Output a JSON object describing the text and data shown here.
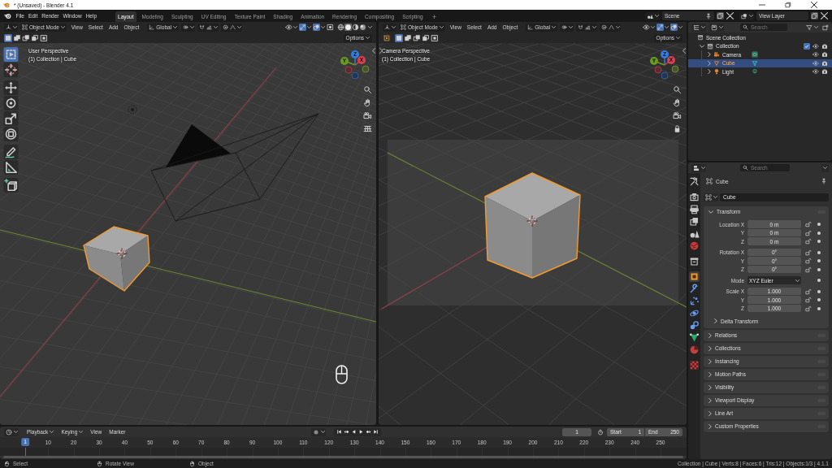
{
  "window": {
    "title": "* (Unsaved) - Blender 4.1"
  },
  "menu": [
    "File",
    "Edit",
    "Render",
    "Window",
    "Help"
  ],
  "workspaces": [
    {
      "label": "Layout",
      "selected": true
    },
    {
      "label": "Modeling",
      "selected": false
    },
    {
      "label": "Sculpting",
      "selected": false
    },
    {
      "label": "UV Editing",
      "selected": false
    },
    {
      "label": "Texture Paint",
      "selected": false
    },
    {
      "label": "Shading",
      "selected": false
    },
    {
      "label": "Animation",
      "selected": false
    },
    {
      "label": "Rendering",
      "selected": false
    },
    {
      "label": "Compositing",
      "selected": false
    },
    {
      "label": "Scripting",
      "selected": false
    }
  ],
  "add_workspace": "+",
  "scene": {
    "name": "Scene"
  },
  "view_layer": {
    "name": "View Layer"
  },
  "viewports": [
    {
      "kind": "user",
      "mode": "Object Mode",
      "menus": [
        "View",
        "Select",
        "Add",
        "Object"
      ],
      "orientation": "Global",
      "toggles": [
        {
          "kind": "visibility",
          "on": false
        },
        {
          "kind": "gizmo",
          "on": true
        },
        {
          "kind": "overlay",
          "on": true
        },
        {
          "kind": "xray",
          "on": false
        }
      ],
      "shading": [
        {
          "kind": "wireframe",
          "selected": false
        },
        {
          "kind": "solid",
          "selected": true
        },
        {
          "kind": "material",
          "selected": false
        },
        {
          "kind": "rendered",
          "selected": false
        }
      ],
      "select_modes": [
        {
          "kind": "set",
          "selected": true
        },
        {
          "kind": "extend",
          "selected": false
        },
        {
          "kind": "subtract",
          "selected": false
        },
        {
          "kind": "invert",
          "selected": false
        },
        {
          "kind": "intersect",
          "selected": false
        }
      ],
      "options": "Options",
      "perspective": "User Perspective",
      "context": "(1) Collection | Cube",
      "axes": [
        "Z",
        "Y",
        "X"
      ],
      "tools": [
        {
          "kind": "select-box",
          "selected": true
        },
        {
          "kind": "cursor",
          "selected": false
        },
        {
          "kind": "move",
          "selected": false
        },
        {
          "kind": "rotate",
          "selected": false
        },
        {
          "kind": "scale",
          "selected": false
        },
        {
          "kind": "transform",
          "selected": false
        },
        {
          "kind": "annotate",
          "selected": false
        },
        {
          "kind": "measure",
          "selected": false
        },
        {
          "kind": "add-cube",
          "selected": false
        }
      ],
      "nav": [
        {
          "kind": "zoom"
        },
        {
          "kind": "pan"
        },
        {
          "kind": "camera"
        },
        {
          "kind": "grid"
        }
      ]
    },
    {
      "kind": "camera",
      "mode": "Object Mode",
      "menus": [
        "View",
        "Select",
        "Add",
        "Object"
      ],
      "orientation": "Global",
      "toggles": [
        {
          "kind": "visibility",
          "on": false
        },
        {
          "kind": "gizmo",
          "on": true
        },
        {
          "kind": "overlay",
          "on": true
        }
      ],
      "active_tool": {
        "kind": "select-box"
      },
      "select_modes": [
        {
          "kind": "set",
          "selected": true
        },
        {
          "kind": "extend",
          "selected": false
        },
        {
          "kind": "subtract",
          "selected": false
        },
        {
          "kind": "invert",
          "selected": false
        },
        {
          "kind": "intersect",
          "selected": false
        }
      ],
      "options": "Options",
      "perspective": "Camera Perspective",
      "context": "(1) Collection | Cube",
      "axes": [
        "Z",
        "Y",
        "X"
      ],
      "nav": [
        {
          "kind": "zoom"
        },
        {
          "kind": "pan"
        },
        {
          "kind": "camera"
        },
        {
          "kind": "lock"
        }
      ]
    }
  ],
  "outliner": {
    "search_placeholder": "Search",
    "tree": [
      {
        "label": "Scene Collection",
        "kind": "scene",
        "selected": false,
        "children": [
          {
            "label": "Collection",
            "kind": "collection",
            "selected": false,
            "expanded": true,
            "checked": true,
            "children": [
              {
                "label": "Camera",
                "kind": "camera",
                "selected": false,
                "expanded": false
              },
              {
                "label": "Cube",
                "kind": "mesh",
                "selected": true,
                "expanded": false
              },
              {
                "label": "Light",
                "kind": "light",
                "selected": false,
                "expanded": false
              }
            ]
          }
        ]
      }
    ]
  },
  "properties": {
    "search_placeholder": "Search",
    "tabs": [
      {
        "kind": "tool",
        "selected": false
      },
      {
        "kind": "render",
        "selected": false
      },
      {
        "kind": "output",
        "selected": false
      },
      {
        "kind": "view-layer",
        "selected": false
      },
      {
        "kind": "scene",
        "selected": false
      },
      {
        "kind": "world",
        "selected": false
      },
      {
        "kind": "collection",
        "selected": false
      },
      {
        "kind": "object",
        "selected": true
      },
      {
        "kind": "modifiers",
        "selected": false
      },
      {
        "kind": "particles",
        "selected": false
      },
      {
        "kind": "physics",
        "selected": false
      },
      {
        "kind": "constraints",
        "selected": false
      },
      {
        "kind": "data",
        "selected": false
      },
      {
        "kind": "material",
        "selected": false
      },
      {
        "kind": "texture",
        "selected": false
      }
    ],
    "context": "Cube",
    "object_name": "Cube",
    "transform": {
      "title": "Transform",
      "expanded": true,
      "groups": [
        [
          {
            "kind": "number",
            "label": "Location X",
            "value": "0 m"
          },
          {
            "kind": "number",
            "label": "Y",
            "value": "0 m"
          },
          {
            "kind": "number",
            "label": "Z",
            "value": "0 m"
          }
        ],
        [
          {
            "kind": "number",
            "label": "Rotation X",
            "value": "0°"
          },
          {
            "kind": "number",
            "label": "Y",
            "value": "0°"
          },
          {
            "kind": "number",
            "label": "Z",
            "value": "0°"
          }
        ],
        [
          {
            "kind": "dropdown",
            "label": "Mode",
            "value": "XYZ Euler"
          }
        ],
        [
          {
            "kind": "number",
            "label": "Scale X",
            "value": "1.000"
          },
          {
            "kind": "number",
            "label": "Y",
            "value": "1.000"
          },
          {
            "kind": "number",
            "label": "Z",
            "value": "1.000"
          }
        ]
      ],
      "subpanels": [
        {
          "title": "Delta Transform",
          "expanded": false
        }
      ]
    },
    "panels": [
      {
        "title": "Relations",
        "expanded": false
      },
      {
        "title": "Collections",
        "expanded": false
      },
      {
        "title": "Instancing",
        "expanded": false
      },
      {
        "title": "Motion Paths",
        "expanded": false
      },
      {
        "title": "Visibility",
        "expanded": false
      },
      {
        "title": "Viewport Display",
        "expanded": false
      },
      {
        "title": "Line Art",
        "expanded": false
      },
      {
        "title": "Custom Properties",
        "expanded": false
      }
    ]
  },
  "timeline": {
    "menus": [
      {
        "label": "Playback",
        "kind": "dropdown"
      },
      {
        "label": "Keying",
        "kind": "dropdown"
      },
      {
        "label": "View",
        "kind": "menu"
      },
      {
        "label": "Marker",
        "kind": "menu"
      }
    ],
    "auto_keying": false,
    "current_frame": "1",
    "start_label": "Start",
    "start": "1",
    "end_label": "End",
    "end": "250",
    "playhead": {
      "label": "1",
      "level": 0
    },
    "ticks": [
      "10",
      "20",
      "30",
      "40",
      "50",
      "60",
      "70",
      "80",
      "90",
      "100",
      "110",
      "120",
      "130",
      "140",
      "150",
      "160",
      "170",
      "180",
      "190",
      "200",
      "210",
      "220",
      "230",
      "240",
      "250"
    ]
  },
  "status": {
    "hints": [
      {
        "kind": "left",
        "label": "Select"
      },
      {
        "kind": "middle",
        "label": "Rotate View"
      },
      {
        "kind": "right",
        "label": "Object"
      }
    ],
    "stats": "Collection | Cube | Verts:8 | Faces:6 | Tris:12 | Objects:1/3 | 4.1.1"
  }
}
